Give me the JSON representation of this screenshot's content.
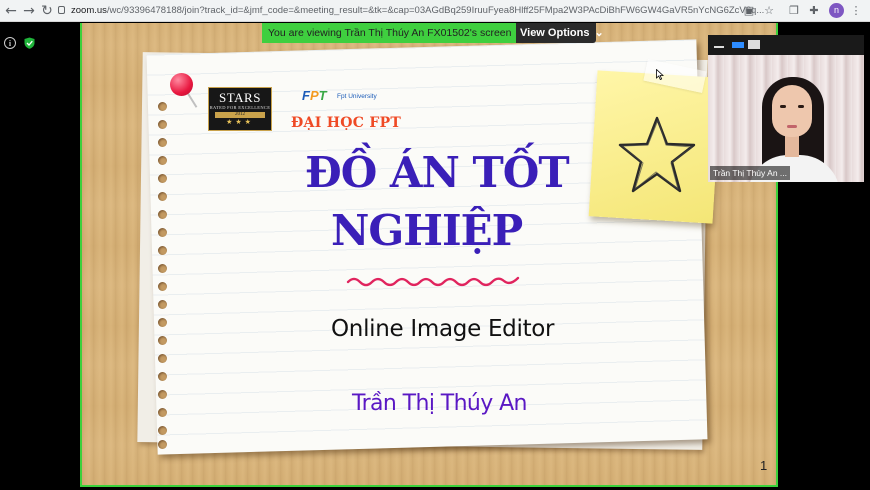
{
  "browser": {
    "url_host": "zoom.us",
    "url_path": "/wc/93396478188/join?track_id=&jmf_code=&meeting_result=&tk=&cap=03AGdBq259IruuFyea8Hlff25FMpa2W3PAcDiBhFW6GW4GaVR5nYcNG6ZcV6q...",
    "profile_initial": "n",
    "icons": [
      "back-arrow-icon",
      "forward-arrow-icon",
      "reload-icon",
      "lock-icon",
      "camera-blocked-icon",
      "star-bookmark-icon",
      "extensions-puzzle-icon",
      "menu-dots-icon"
    ]
  },
  "meeting": {
    "viewing_banner": "You are viewing Trần Thị Thúy An FX01502's screen",
    "view_options_label": "View Options",
    "accent_color": "#3fcf3f"
  },
  "slide": {
    "stars_logo": {
      "title": "STARS",
      "subtitle": "RATED FOR EXCELLENCE",
      "year": "2012",
      "stars": "★★★"
    },
    "fpt_logo": {
      "f": "F",
      "p": "P",
      "t": "T",
      "university": "Fpt University"
    },
    "school": "ĐẠI HỌC FPT",
    "title_line1": "ĐỒ ÁN TỐT",
    "title_line2": "NGHIỆP",
    "subtitle": "Online Image Editor",
    "author": "Trần Thị Thúy An",
    "page_number": "1"
  },
  "video": {
    "participant_name": "Trần Thị Thúy An ..."
  }
}
